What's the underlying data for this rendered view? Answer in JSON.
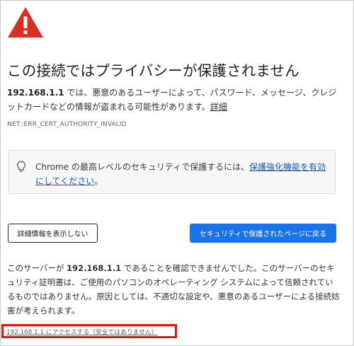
{
  "page": {
    "title": "この接続ではプライバシーが保護されません",
    "icon": "warning-triangle-icon",
    "accent_color": "#1a73e8",
    "warning_color": "#d93025"
  },
  "description": {
    "host": "192.168.1.1",
    "text": " では、悪意のあるユーザーによって、パスワード、メッセージ、クレジットカードなどの情報が盗まれる可能性があります。",
    "details_link": "詳細"
  },
  "error_code": "NET::ERR_CERT_AUTHORITY_INVALID",
  "protection": {
    "icon": "lightbulb-icon",
    "text": "Chrome の最高レベルのセキュリティで保護するには、",
    "link": "保護強化機能を有効にしてください",
    "suffix": "。"
  },
  "buttons": {
    "details": "詳細情報を表示しない",
    "back": "セキュリティで保護されたページに戻る"
  },
  "explanation": {
    "prefix": "このサーバーが ",
    "host": "192.168.1.1",
    "text": " であることを確認できませんでした。このサーバーのセキュリティ証明書は、ご使用のパソコンのオペレーティング システムによって信頼されているものではありません。原因としては、不適切な設定や、悪意のあるユーザーによる接続妨害が考えられます。"
  },
  "proceed_link": "192.168.1.1 にアクセスする（安全ではありません）",
  "highlight_color": "#ee1111"
}
